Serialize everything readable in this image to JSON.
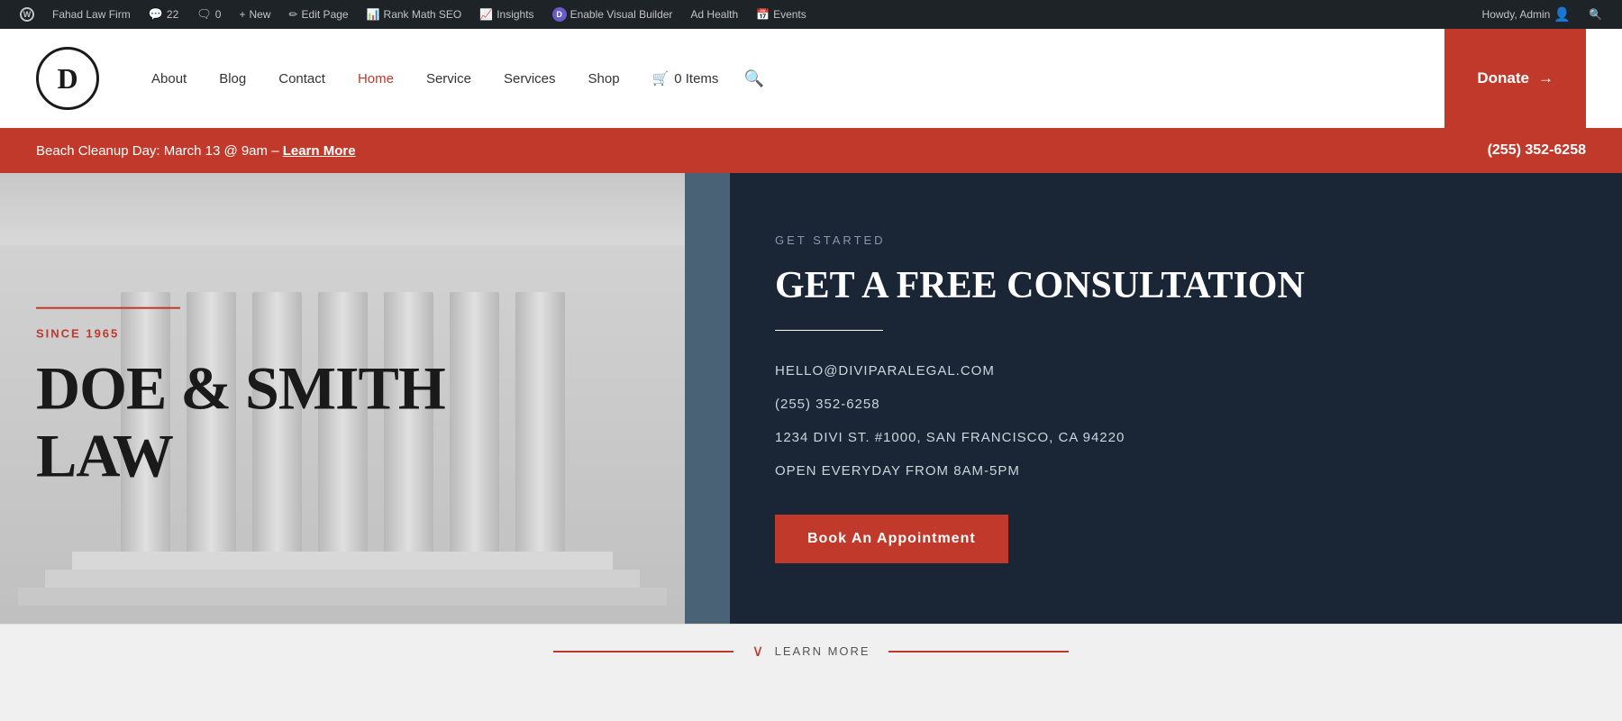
{
  "admin_bar": {
    "site_name": "Fahad Law Firm",
    "comments_count": "22",
    "notes_count": "0",
    "new_label": "New",
    "edit_page_label": "Edit Page",
    "rank_math_label": "Rank Math SEO",
    "insights_label": "Insights",
    "enable_vb_label": "Enable Visual Builder",
    "ad_health_label": "Ad Health",
    "events_label": "Events",
    "howdy_label": "Howdy, Admin"
  },
  "header": {
    "logo_letter": "D",
    "nav_items": [
      {
        "label": "About",
        "active": false
      },
      {
        "label": "Blog",
        "active": false
      },
      {
        "label": "Contact",
        "active": false
      },
      {
        "label": "Home",
        "active": true
      },
      {
        "label": "Service",
        "active": false
      },
      {
        "label": "Services",
        "active": false
      },
      {
        "label": "Shop",
        "active": false
      }
    ],
    "cart_label": "0 Items",
    "donate_label": "Donate",
    "donate_arrow": "→"
  },
  "banner": {
    "text": "Beach Cleanup Day: March 13 @ 9am –",
    "link_text": "Learn More",
    "phone": "(255) 352-6258"
  },
  "hero": {
    "since_label": "SINCE 1965",
    "firm_name_line1": "DOE & SMITH",
    "firm_name_line2": "LAW"
  },
  "consultation": {
    "get_started_label": "GET STARTED",
    "title": "GET A FREE CONSULTATION",
    "email": "HELLO@DIVIPARALEGAL.COM",
    "phone": "(255) 352-6258",
    "address": "1234 DIVI ST. #1000, SAN FRANCISCO, CA 94220",
    "hours": "OPEN EVERYDAY FROM 8AM-5PM",
    "book_btn": "Book An Appointment"
  },
  "footer_strip": {
    "learn_more_label": "LEARN MORE"
  }
}
